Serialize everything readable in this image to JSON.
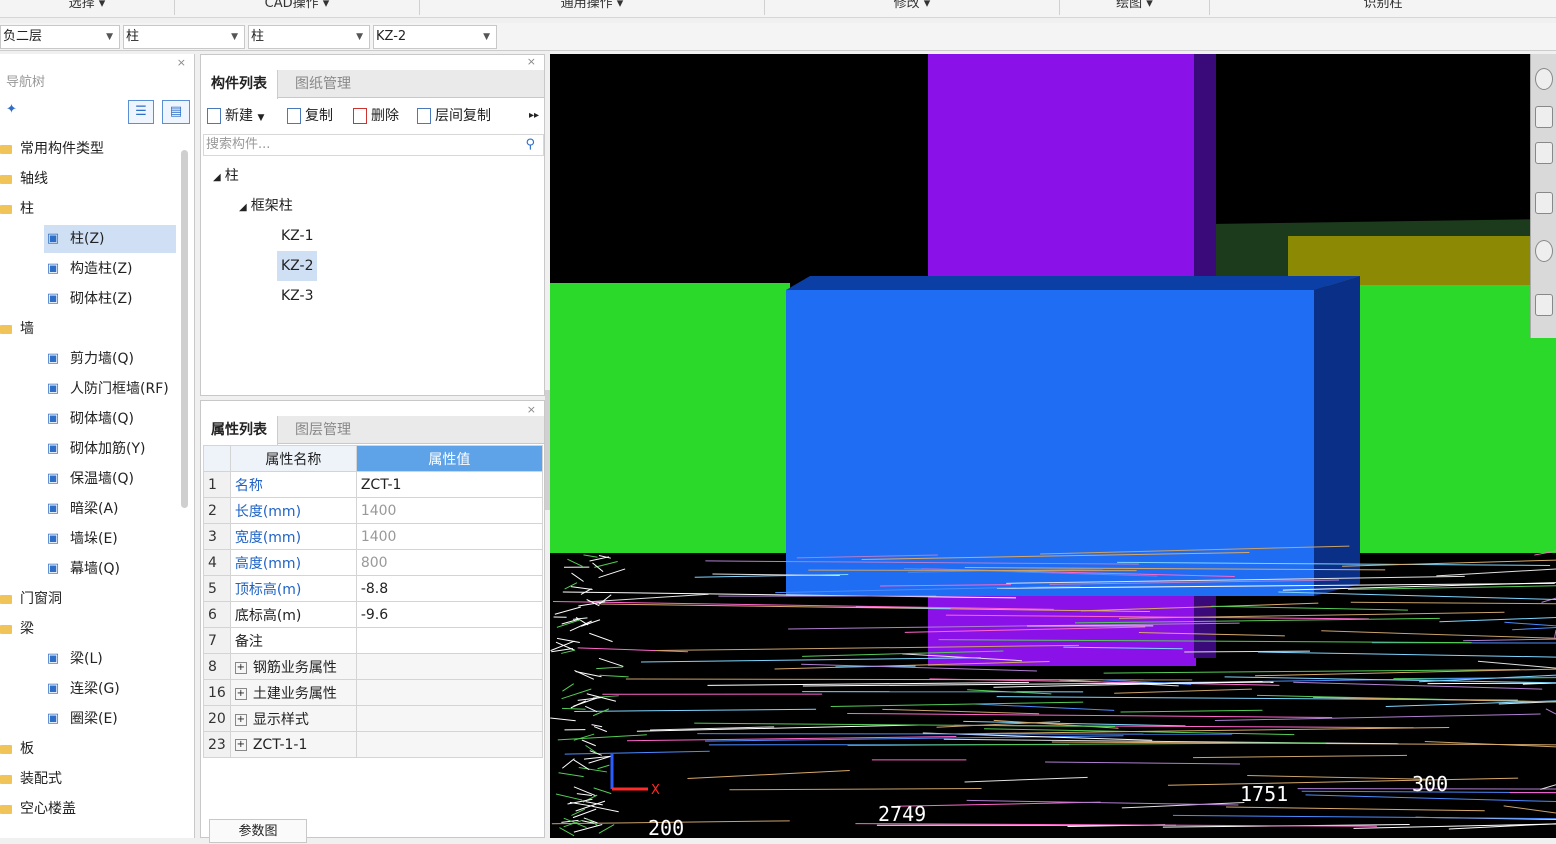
{
  "ribbon": {
    "groups": [
      "选择 ▾",
      "CAD操作 ▾",
      "通用操作 ▾",
      "修改 ▾",
      "绘图 ▾",
      "识别柱"
    ]
  },
  "selectors": {
    "floor": "负二层",
    "category": "柱",
    "type": "柱",
    "component": "KZ-2"
  },
  "nav": {
    "title": "导航树",
    "items": [
      {
        "label": "常用构件类型",
        "level": 0
      },
      {
        "label": "轴线",
        "level": 0
      },
      {
        "label": "柱",
        "level": 0
      },
      {
        "label": "柱(Z)",
        "level": 1,
        "icon": "column-icon",
        "selected": true
      },
      {
        "label": "构造柱(Z)",
        "level": 1,
        "icon": "construct-column-icon"
      },
      {
        "label": "砌体柱(Z)",
        "level": 1,
        "icon": "masonry-column-icon"
      },
      {
        "label": "墙",
        "level": 0
      },
      {
        "label": "剪力墙(Q)",
        "level": 1,
        "icon": "shear-wall-icon"
      },
      {
        "label": "人防门框墙(RF)",
        "level": 1,
        "icon": "door-frame-wall-icon"
      },
      {
        "label": "砌体墙(Q)",
        "level": 1,
        "icon": "masonry-wall-icon"
      },
      {
        "label": "砌体加筋(Y)",
        "level": 1,
        "icon": "masonry-rebar-icon"
      },
      {
        "label": "保温墙(Q)",
        "level": 1,
        "icon": "insulation-wall-icon"
      },
      {
        "label": "暗梁(A)",
        "level": 1,
        "icon": "hidden-beam-icon"
      },
      {
        "label": "墙垛(E)",
        "level": 1,
        "icon": "wall-pier-icon"
      },
      {
        "label": "幕墙(Q)",
        "level": 1,
        "icon": "curtain-wall-icon"
      },
      {
        "label": "门窗洞",
        "level": 0
      },
      {
        "label": "梁",
        "level": 0
      },
      {
        "label": "梁(L)",
        "level": 1,
        "icon": "beam-icon"
      },
      {
        "label": "连梁(G)",
        "level": 1,
        "icon": "link-beam-icon"
      },
      {
        "label": "圈梁(E)",
        "level": 1,
        "icon": "ring-beam-icon"
      },
      {
        "label": "板",
        "level": 0
      },
      {
        "label": "装配式",
        "level": 0
      },
      {
        "label": "空心楼盖",
        "level": 0
      }
    ]
  },
  "component_panel": {
    "tabs": [
      "构件列表",
      "图纸管理"
    ],
    "toolbar": {
      "new": "新建",
      "copy": "复制",
      "delete": "删除",
      "floor_copy": "层间复制"
    },
    "search_placeholder": "搜索构件...",
    "tree": {
      "root": "柱",
      "group": "框架柱",
      "items": [
        "KZ-1",
        "KZ-2",
        "KZ-3"
      ],
      "selected": "KZ-2"
    }
  },
  "props_panel": {
    "tabs": [
      "属性列表",
      "图层管理"
    ],
    "header": {
      "name": "属性名称",
      "value": "属性值"
    },
    "rows": [
      {
        "num": "1",
        "name": "名称",
        "value": "ZCT-1"
      },
      {
        "num": "2",
        "name": "长度(mm)",
        "value": "1400"
      },
      {
        "num": "3",
        "name": "宽度(mm)",
        "value": "1400"
      },
      {
        "num": "4",
        "name": "高度(mm)",
        "value": "800"
      },
      {
        "num": "5",
        "name": "顶标高(m)",
        "value": "-8.8"
      },
      {
        "num": "6",
        "name": "底标高(m)",
        "value": "-9.6"
      },
      {
        "num": "7",
        "name": "备注",
        "value": ""
      },
      {
        "num": "8",
        "name": "钢筋业务属性",
        "value": ""
      },
      {
        "num": "16",
        "name": "土建业务属性",
        "value": ""
      },
      {
        "num": "20",
        "name": "显示样式",
        "value": ""
      },
      {
        "num": "23",
        "name": "ZCT-1-1",
        "value": ""
      }
    ],
    "param_button": "参数图"
  },
  "viewport": {
    "labels": [
      "2749",
      "1751",
      "300",
      "200"
    ],
    "colors": {
      "column": "#8a12e8",
      "cap": "#1e6df2",
      "slab": "#2bd92b",
      "beam": "#8b8b00"
    }
  }
}
